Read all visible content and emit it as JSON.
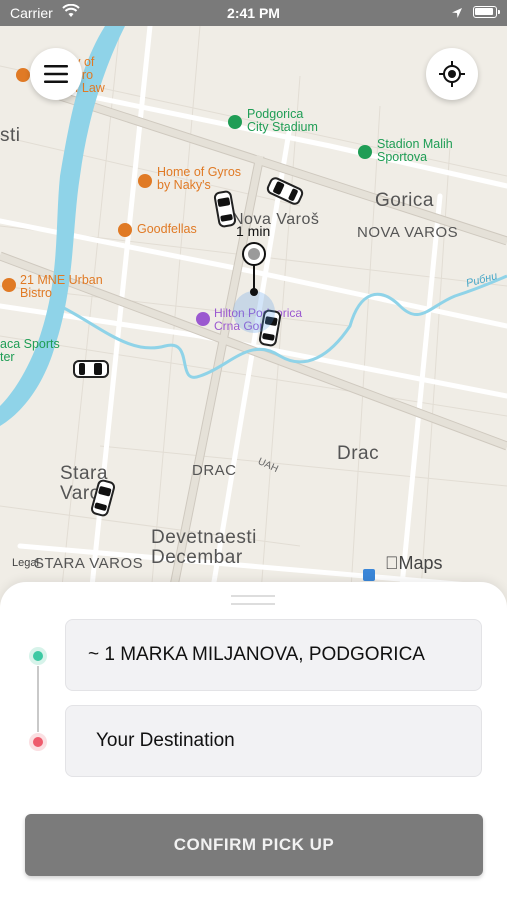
{
  "status_bar": {
    "carrier": "Carrier",
    "time": "2:41 PM"
  },
  "map": {
    "eta_label": "1 min",
    "legal": "Legal",
    "attribution": "Maps",
    "places": {
      "university": "ity of\negro\nof Law",
      "stadium": "Podgorica\nCity Stadium",
      "malih": "Stadion Malih\nSportova",
      "gyros": "Home of Gyros\nby Naky's",
      "goodfellas": "Goodfellas",
      "mne": "21 MNE Urban\nBistro",
      "hilton": "Hilton Podgorica\nCrna Gora",
      "sports": "aca Sports\nter",
      "gorica": "Gorica",
      "nova_varos_caps": "NOVA VAROS",
      "nova_varos": "Nova Varoš",
      "drac": "Drac",
      "drac_caps": "DRAC",
      "uah": "UAH",
      "stara": "Stara\nVaroš",
      "devet": "Devetnaesti\nDecembar",
      "stara_caps": "STARA VAROS",
      "sti": "sti",
      "river": "Рибни"
    }
  },
  "pickup_value": "~ 1 MARKA MILJANOVA, PODGORICA",
  "destination_placeholder": "Your Destination",
  "confirm_label": "CONFIRM PICK UP",
  "colors": {
    "pickup_marker": "#3cc9a3",
    "destination_marker": "#ee5b6c",
    "confirm_button": "#7b7b7b",
    "river": "#8fd3e8"
  }
}
